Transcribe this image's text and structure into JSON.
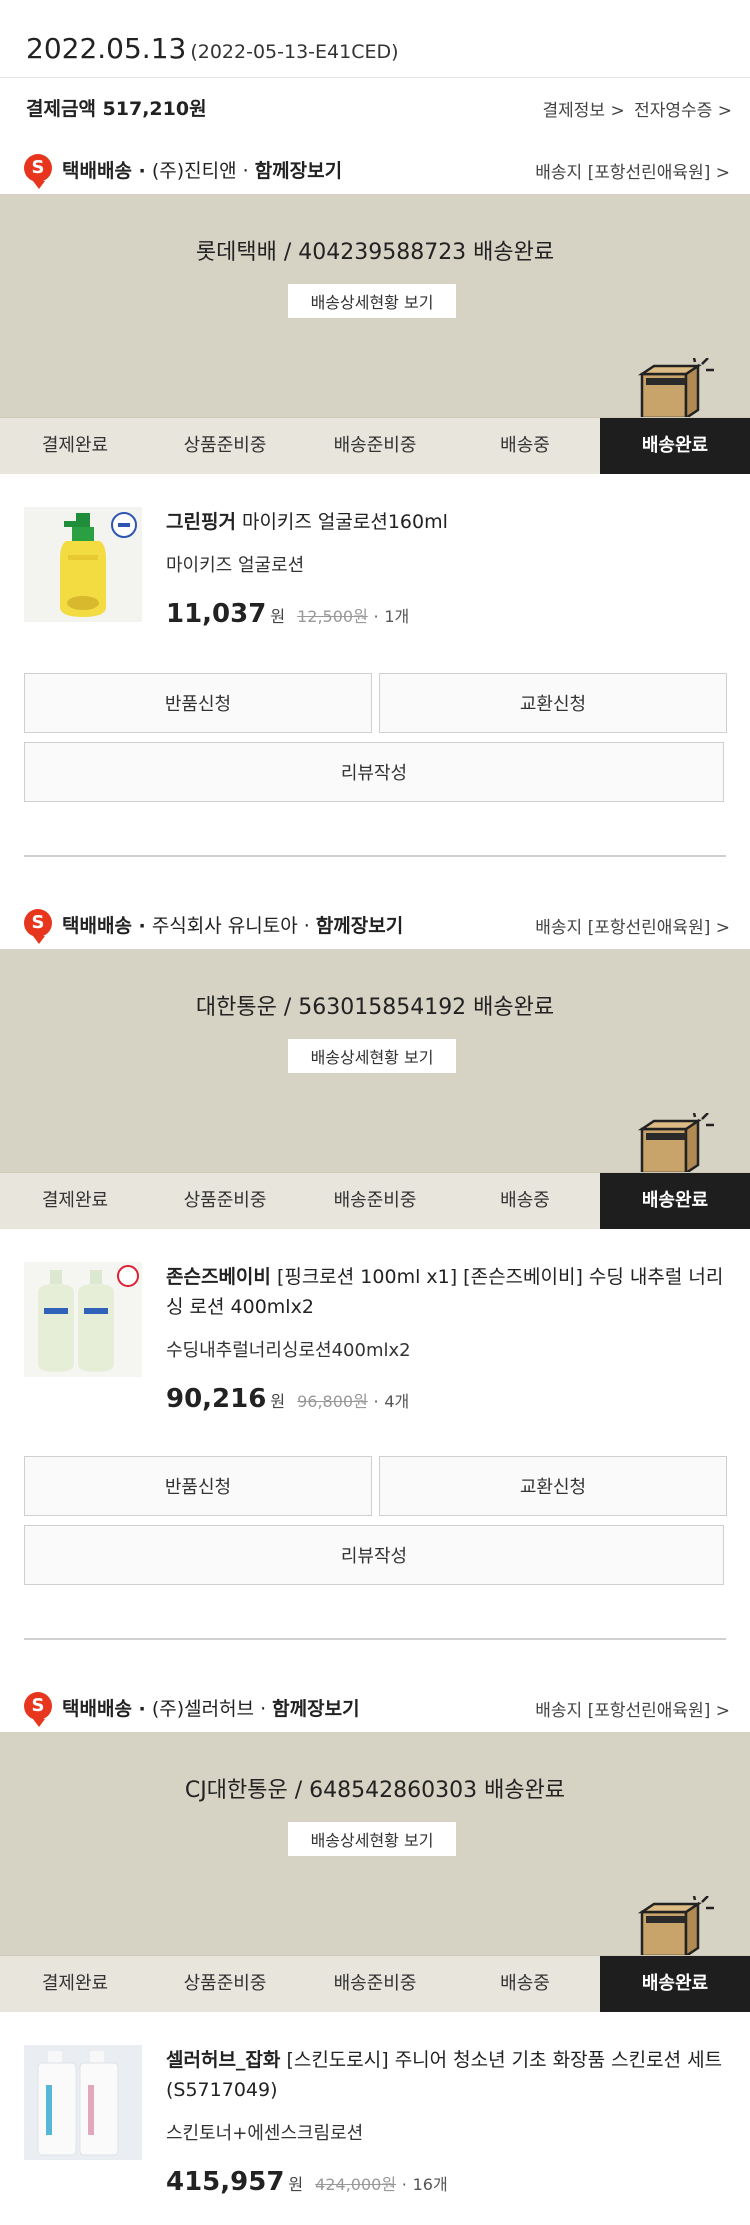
{
  "header": {
    "date": "2022.05.13",
    "order_code": "(2022-05-13-E41CED)",
    "payment_label": "결제금액 517,210원",
    "payment_info_link": "결제정보 >",
    "receipt_link": "전자영수증 >"
  },
  "colors": {
    "accent": "#e8361e",
    "track_bg": "#d6d2c4",
    "active_step": "#1e1e1e"
  },
  "steps": [
    "결제완료",
    "상품준비중",
    "배송준비중",
    "배송중",
    "배송완료"
  ],
  "common": {
    "track_detail_button": "배송상세현황 보기",
    "return_button": "반품신청",
    "exchange_button": "교환신청",
    "review_button": "리뷰작성",
    "won": "원",
    "qty_sep": "·",
    "badge": "S"
  },
  "shipments": [
    {
      "delivery_type": "택배배송 ·",
      "seller": "(주)진티앤 ·",
      "bundle_link": "함께장보기",
      "destination": "배송지 [포항선린애육원] >",
      "tracking": "롯데택배 / 404239588723 배송완료",
      "brand": "그린핑거",
      "product_name": "마이키즈 얼굴로션160ml",
      "option": "마이키즈 얼굴로션",
      "price": "11,037",
      "original_price": "12,500원",
      "quantity": "1개",
      "thumb_icon": "lotion-bottle-icon"
    },
    {
      "delivery_type": "택배배송 ·",
      "seller": "주식회사 유니토아 ·",
      "bundle_link": "함께장보기",
      "destination": "배송지 [포항선린애육원] >",
      "tracking": "대한통운 / 563015854192 배송완료",
      "brand": "존슨즈베이비",
      "product_name": "[핑크로션 100ml x1] [존슨즈베이비] 수딩 내추럴 너리싱 로션 400mlx2",
      "option": "수딩내추럴너리싱로션400mlx2",
      "price": "90,216",
      "original_price": "96,800원",
      "quantity": "4개",
      "thumb_icon": "pump-bottles-icon"
    },
    {
      "delivery_type": "택배배송 ·",
      "seller": "(주)셀러허브 ·",
      "bundle_link": "함께장보기",
      "destination": "배송지 [포항선린애육원] >",
      "tracking": "CJ대한통운 / 648542860303 배송완료",
      "brand": "셀러허브_잡화",
      "product_name": "[스킨도로시] 주니어 청소년 기초 화장품 스킨로션 세트 (S5717049)",
      "option": "스킨토너+에센스크림로션",
      "price": "415,957",
      "original_price": "424,000원",
      "quantity": "16개",
      "thumb_icon": "skincare-set-icon"
    }
  ]
}
